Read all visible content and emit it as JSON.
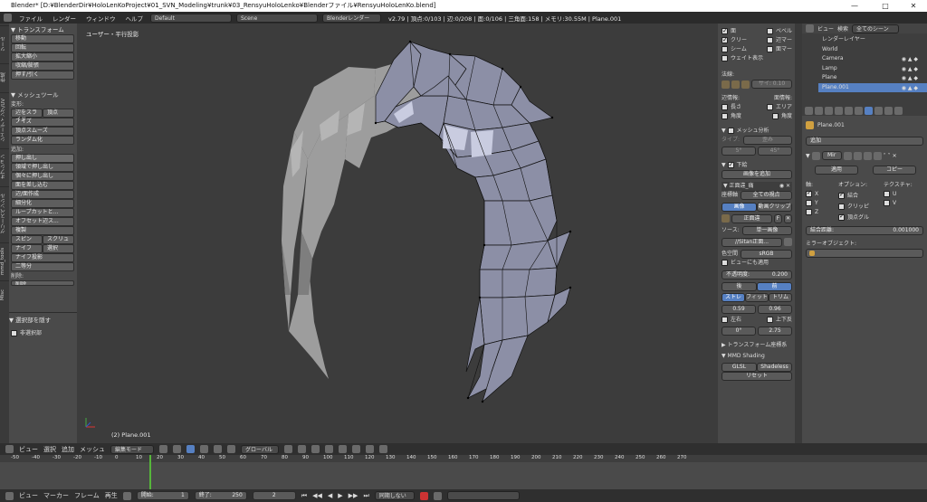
{
  "window": {
    "title": "Blender* [D:¥BlenderDir¥HoloLenKoProject¥01_SVN_Modeling¥trunk¥03_RensyuHoloLenko¥Blenderファイル¥RensyuHoloLenKo.blend]",
    "minimize": "—",
    "maximize": "□",
    "close": "✕"
  },
  "menubar": {
    "items": [
      "ファイル",
      "レンダー",
      "ウィンドウ",
      "ヘルプ"
    ],
    "layout_value": "Default",
    "scene_value": "Scene",
    "engine_value": "Blenderレンダー",
    "stats": "v2.79 | 頂点:0/103 | 辺:0/208 | 面:0/106 | 三角面:158 | メモリ:30.55M | Plane.001"
  },
  "toolshelf": {
    "tabs": [
      "ツール",
      "作成",
      "シェーディング/UV",
      "オプション",
      "グリースペンシル",
      "mmd_tools",
      "Misc"
    ],
    "transform_header": "▼ トランスフォーム",
    "transform_buttons": [
      "移動",
      "回転",
      "拡大縮小",
      "収縮/膨張",
      "押す/引く"
    ],
    "mesh_tools_header": "▼ メッシュツール",
    "deform_label": "変形:",
    "deform_row1": [
      "辺をスライド",
      "頂点"
    ],
    "deform_buttons": [
      "ノイズ",
      "頂点スムーズ",
      "ランダム化"
    ],
    "add_label": "追加:",
    "add_buttons": [
      "押し出し",
      "領域で押し出し",
      "個々に押し出し",
      "面を差し込む",
      "辺/面作成",
      "細分化",
      "ループカットと...",
      "オフセット辺ス...",
      "複製"
    ],
    "add_row_spin": [
      "スピン",
      "スクリュー"
    ],
    "add_row_knife": [
      "ナイフ",
      "選択"
    ],
    "add_buttons2": [
      "ナイフ投影",
      "二等分"
    ],
    "delete_label": "削除:",
    "delete_button": "削除",
    "op_header": "▼ 選択部を隠す",
    "op_checkbox": "非選択部"
  },
  "viewport": {
    "view_label": "ユーザー・平行投影",
    "object_label": "(2) Plane.001"
  },
  "npanel": {
    "overlays": [
      {
        "label": "面",
        "on": true
      },
      {
        "label": "ベベル",
        "on": false
      },
      {
        "label": "クリー",
        "on": true
      },
      {
        "label": "辺マー",
        "on": false
      },
      {
        "label": "シーム",
        "on": false
      },
      {
        "label": "面マー",
        "on": false
      }
    ],
    "weight_display": "ウェイト表示",
    "normals_label": "法線:",
    "normals_size": "サイ: 0.10",
    "edge_info_label": "辺情報:",
    "face_info_label": "面情報:",
    "edge_info": [
      {
        "label": "長さ",
        "on": false
      },
      {
        "label": "角度",
        "on": false
      }
    ],
    "face_info": [
      {
        "label": "エリア",
        "on": false
      },
      {
        "label": "角度",
        "on": false
      }
    ],
    "mesh_analysis": "メッシュ分析",
    "type_label": "タイプ:",
    "type_value": "歪み",
    "angle_min": "5°",
    "angle_max": "45°",
    "background_header": "下絵",
    "add_image_button": "画像を追加",
    "image_name": "正面違_痛",
    "axis_label": "座標軸",
    "axis_value": "全ての視点",
    "source_tabs": [
      "画像",
      "動画クリップ"
    ],
    "image_field": "正面違",
    "source_label": "ソース:",
    "source_value": "単一画像",
    "file_value": "//Sitan正面...",
    "colorspace_label": "色空間",
    "colorspace_value": "sRGB",
    "view_too": "ビューにも適用",
    "opacity_label": "不透明度:",
    "opacity_value": "0.200",
    "back_front": [
      "後",
      "前"
    ],
    "fit_tabs": [
      "ストレ",
      "フィット",
      "トリム"
    ],
    "size_x": "0.59",
    "size_y": "0.96",
    "flip_x": "左右",
    "flip_y": "上下反",
    "rotation": "0°",
    "rotation_val2": "2.75",
    "transform_orient": "トランスフォーム座標系",
    "mmd_shading": "MMD Shading",
    "glsl": "GLSL",
    "shadeless": "Shadeless",
    "reset": "リセット"
  },
  "outliner": {
    "view_label": "ビュー",
    "search_label": "検索",
    "scene_dropdown": "全てのシーン",
    "items": [
      "レンダーレイヤー",
      "World",
      "Camera",
      "Lamp",
      "Plane",
      "Plane.001"
    ]
  },
  "properties": {
    "object_name": "Plane.001",
    "add_label": "追加",
    "mod_name": "Mir",
    "apply": "適用",
    "copy": "コピー",
    "axis_label": "軸:",
    "options_label": "オプション:",
    "texture_label": "テクスチャ:",
    "axes": [
      {
        "label": "X",
        "on": true
      },
      {
        "label": "Y",
        "on": false
      },
      {
        "label": "Z",
        "on": false
      }
    ],
    "options": [
      {
        "label": "結合",
        "on": true
      },
      {
        "label": "クリッピ",
        "on": false
      },
      {
        "label": "頂点グル",
        "on": true
      }
    ],
    "textures": [
      {
        "label": "U",
        "on": false
      },
      {
        "label": "V",
        "on": false
      }
    ],
    "merge_label": "結合距離:",
    "merge_value": "0.001000",
    "mirror_obj_label": "ミラーオブジェクト:"
  },
  "bottom_header": {
    "items": [
      "ビュー",
      "選択",
      "追加",
      "メッシュ"
    ],
    "mode": "編集モード",
    "orientation": "グローバル"
  },
  "timeline": {
    "ticks": [
      "-50",
      "-40",
      "-30",
      "-20",
      "-10",
      "0",
      "10",
      "20",
      "30",
      "40",
      "50",
      "60",
      "70",
      "80",
      "90",
      "100",
      "110",
      "120",
      "130",
      "140",
      "150",
      "160",
      "170",
      "180",
      "190",
      "200",
      "210",
      "220",
      "230",
      "240",
      "250",
      "260",
      "270"
    ],
    "items": [
      "ビュー",
      "マーカー",
      "フレーム",
      "再生"
    ],
    "start_label": "開始:",
    "start": "1",
    "end_label": "終了:",
    "end": "250",
    "current": "2",
    "sync": "同期しない"
  },
  "colors": {
    "accent": "#5680c2",
    "mesh_face": "#8c8fa6",
    "mesh_edge": "#111111",
    "viewport_bg": "#3c3c3c",
    "current_frame": "#56b63a"
  }
}
